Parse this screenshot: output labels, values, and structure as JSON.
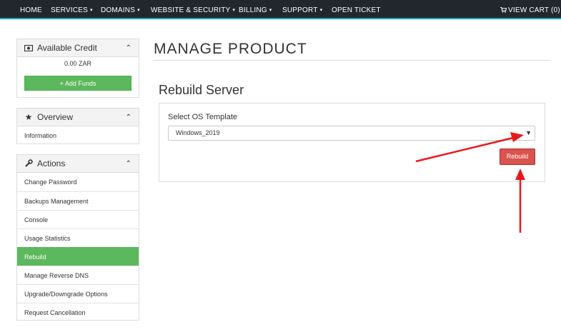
{
  "nav": {
    "items": [
      {
        "label": "HOME",
        "dropdown": false
      },
      {
        "label": "SERVICES",
        "dropdown": true
      },
      {
        "label": "DOMAINS",
        "dropdown": true
      },
      {
        "label": "WEBSITE & SECURITY",
        "dropdown": true
      },
      {
        "label": "BILLING",
        "dropdown": true
      },
      {
        "label": "SUPPORT",
        "dropdown": true
      },
      {
        "label": "OPEN TICKET",
        "dropdown": false
      }
    ],
    "cart_label": "VIEW CART (0)",
    "caret": "▾"
  },
  "sidebar": {
    "credit": {
      "title": "Available Credit",
      "value": "0.00 ZAR",
      "add_funds_label": "+ Add Funds"
    },
    "overview": {
      "title": "Overview",
      "items": [
        {
          "label": "Information"
        }
      ]
    },
    "actions": {
      "title": "Actions",
      "items": [
        {
          "label": "Change Password"
        },
        {
          "label": "Backups Management"
        },
        {
          "label": "Console"
        },
        {
          "label": "Usage Statistics"
        },
        {
          "label": "Rebuild",
          "active": true
        },
        {
          "label": "Manage Reverse DNS"
        },
        {
          "label": "Upgrade/Downgrade Options"
        },
        {
          "label": "Request Cancellation"
        }
      ]
    },
    "collapse_glyph": "⌃"
  },
  "main": {
    "title": "MANAGE PRODUCT",
    "section_title": "Rebuild Server",
    "field_label": "Select OS Template",
    "os_selected": "Windows_2019",
    "rebuild_label": "Rebuild"
  },
  "colors": {
    "nav_bg": "#21272d",
    "success": "#5cb85c",
    "danger": "#d9534f",
    "annotation": "#e8191c"
  }
}
